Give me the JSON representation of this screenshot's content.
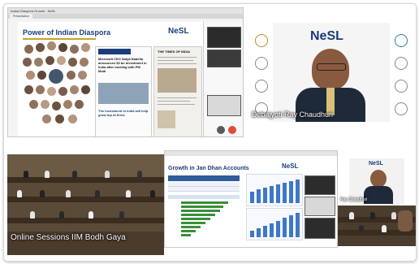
{
  "tile1": {
    "window_title": "Indian Diaspora Growth - NeSL",
    "tab_label": "Presentation",
    "slide_title": "Power of Indian Diaspora",
    "logo_text": "NeSL",
    "news_headline": "Microsoft CEO Satya Nadella announces $3 bn investment in India after meeting with PM Modi",
    "news_sub": "The investment in India will help grow top AI firms",
    "paper_title": "THE TIMES OF INDIA"
  },
  "tile2": {
    "banner_logo": "NeSL",
    "speaker_name": "Debajyoti Ray Chaudhuri"
  },
  "tile3": {
    "caption": "Online Sessions IIM Bodh Gaya"
  },
  "tile4": {
    "slide_title": "Growth in Jan Dhan Accounts",
    "logo_text": "NeSL"
  },
  "tile5": {
    "speaker_name": "Ray Chaudhuri"
  },
  "colors": {
    "brand_blue": "#1b3c7a",
    "brand_red": "#d23a2a",
    "accent_gold": "#c9a227",
    "table_blue": "#2f5b9a",
    "bar_green": "#3a8f3a"
  }
}
